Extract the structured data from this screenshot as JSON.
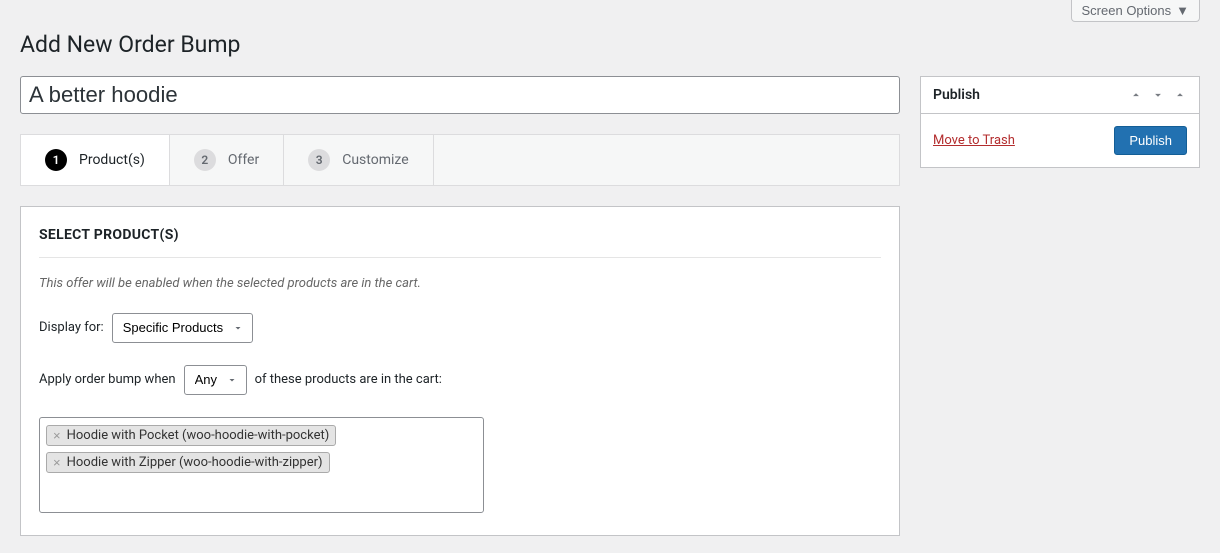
{
  "screenOptions": {
    "label": "Screen Options"
  },
  "page": {
    "title": "Add New Order Bump"
  },
  "order": {
    "title_value": "A better hoodie"
  },
  "tabs": [
    {
      "num": "1",
      "label": "Product(s)",
      "active": true
    },
    {
      "num": "2",
      "label": "Offer",
      "active": false
    },
    {
      "num": "3",
      "label": "Customize",
      "active": false
    }
  ],
  "section": {
    "heading": "SELECT PRODUCT(S)",
    "hint": "This offer will be enabled when the selected products are in the cart.",
    "display_for_label": "Display for:",
    "display_for_value": "Specific Products",
    "apply_pre_text": "Apply order bump when",
    "apply_select_value": "Any",
    "apply_post_text": "of these products are in the cart:",
    "products": [
      "Hoodie with Pocket (woo-hoodie-with-pocket)",
      "Hoodie with Zipper (woo-hoodie-with-zipper)"
    ]
  },
  "publish": {
    "heading": "Publish",
    "trash": "Move to Trash",
    "button": "Publish"
  }
}
